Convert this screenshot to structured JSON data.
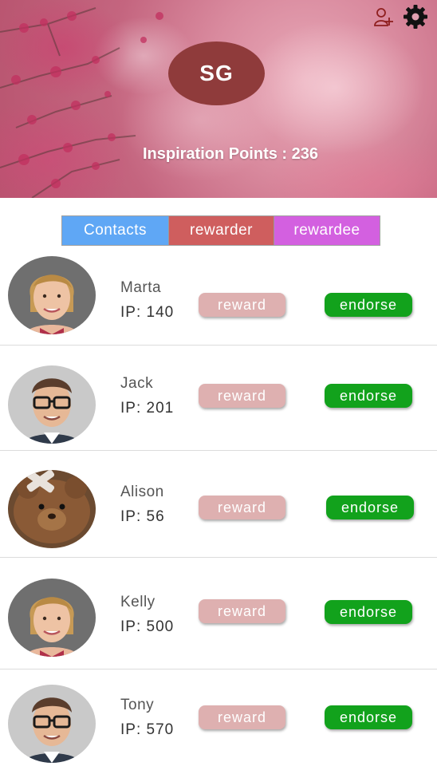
{
  "header": {
    "initials": "SG",
    "inspiration_points": "Inspiration Points : 236",
    "icons": [
      "add-user-icon",
      "gear-icon"
    ]
  },
  "tabs": [
    {
      "label": "Contacts",
      "color": "#5fa7f5"
    },
    {
      "label": "rewarder",
      "color": "#cf5e5e"
    },
    {
      "label": "rewardee",
      "color": "#d360e0"
    }
  ],
  "buttons": {
    "reward_label": "reward",
    "endorse_label": "endorse"
  },
  "contacts": [
    {
      "name": "Marta",
      "ip": "IP: 140",
      "avatar": "woman-photo"
    },
    {
      "name": "Jack",
      "ip": "IP: 201",
      "avatar": "man-glasses-photo"
    },
    {
      "name": "Alison",
      "ip": "IP: 56",
      "avatar": "teddy-bear-photo"
    },
    {
      "name": "Kelly",
      "ip": "IP: 500",
      "avatar": "woman-photo"
    },
    {
      "name": "Tony",
      "ip": "IP: 570",
      "avatar": "man-glasses-photo"
    }
  ],
  "colors": {
    "reward_button": "#deb0b0",
    "endorse_button": "#12a21c",
    "initials_bg": "#8f3b3b"
  }
}
